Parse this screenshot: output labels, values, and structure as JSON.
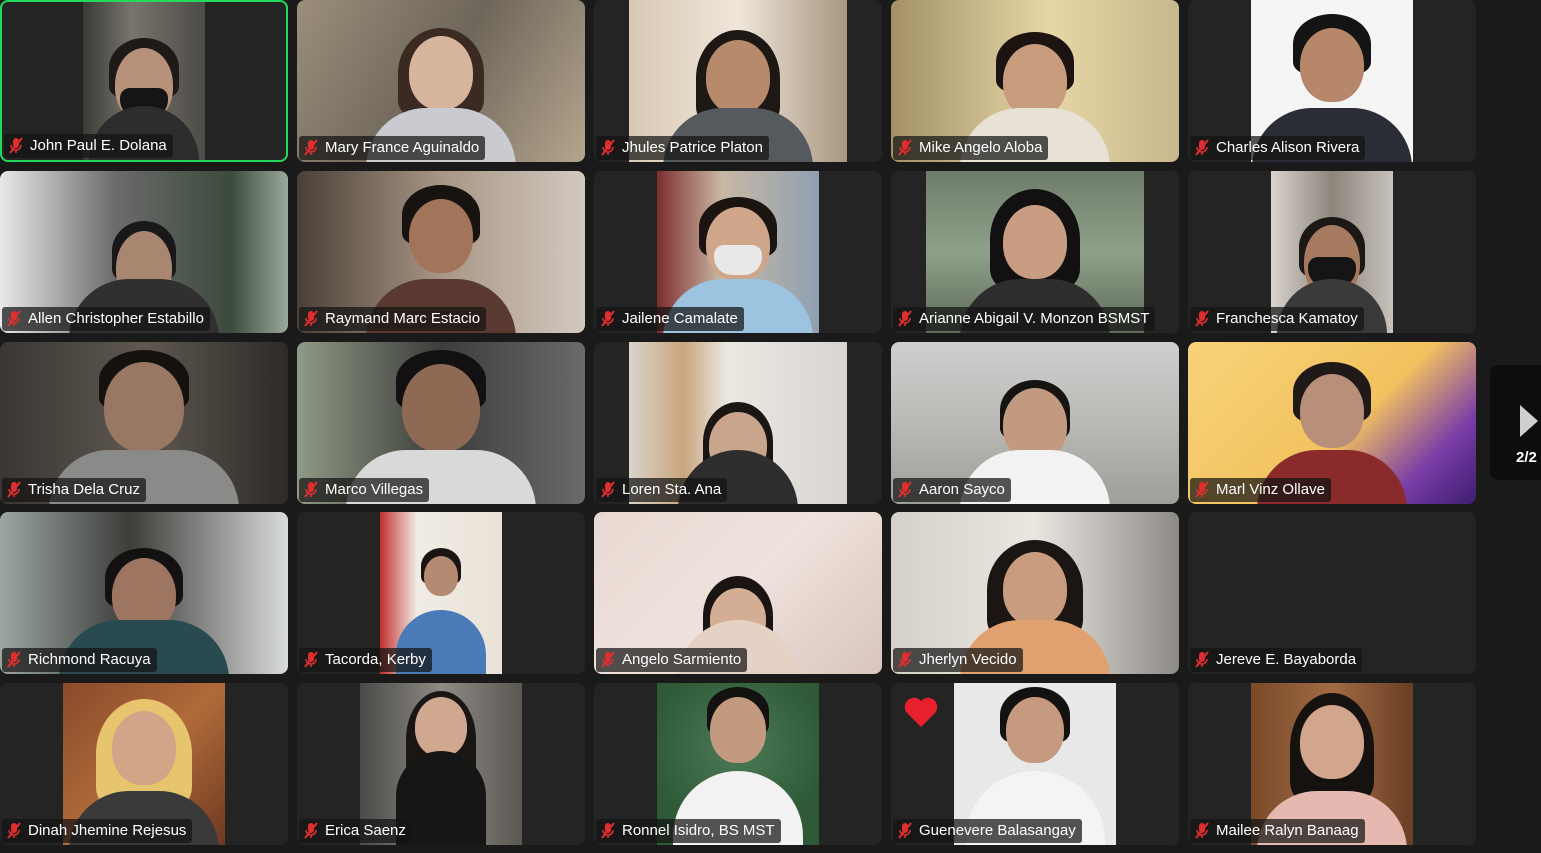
{
  "pagination": {
    "page_indicator": "2/2"
  },
  "colors": {
    "active_speaker_border": "#23d959",
    "muted_icon": "#e02e2e",
    "background": "#1a1a1a",
    "tile_background": "#242424"
  },
  "participants": [
    {
      "name": "John Paul E. Dolana",
      "muted": true,
      "active": true
    },
    {
      "name": "Mary France Aguinaldo",
      "muted": true
    },
    {
      "name": "Jhules Patrice Platon",
      "muted": true
    },
    {
      "name": "Mike Angelo Aloba",
      "muted": true
    },
    {
      "name": "Charles Alison Rivera",
      "muted": true
    },
    {
      "name": "Allen Christopher Estabillo",
      "muted": true
    },
    {
      "name": "Raymand Marc Estacio",
      "muted": true
    },
    {
      "name": "Jailene Camalate",
      "muted": true
    },
    {
      "name": "Arianne Abigail V. Monzon BSMST",
      "muted": true
    },
    {
      "name": "Franchesca Kamatoy",
      "muted": true
    },
    {
      "name": "Trisha Dela Cruz",
      "muted": true
    },
    {
      "name": "Marco Villegas",
      "muted": true
    },
    {
      "name": "Loren Sta. Ana",
      "muted": true
    },
    {
      "name": "Aaron Sayco",
      "muted": true
    },
    {
      "name": "Marl Vinz Ollave",
      "muted": true
    },
    {
      "name": "Richmond Racuya",
      "muted": true
    },
    {
      "name": "Tacorda, Kerby",
      "muted": true
    },
    {
      "name": "Angelo Sarmiento",
      "muted": true
    },
    {
      "name": "Jherlyn Vecido",
      "muted": true
    },
    {
      "name": "Jereve E. Bayaborda",
      "muted": true,
      "video_off": true
    },
    {
      "name": "Dinah Jhemine Rejesus",
      "muted": true
    },
    {
      "name": "Erica Saenz",
      "muted": true
    },
    {
      "name": "Ronnel Isidro, BS MST",
      "muted": true
    },
    {
      "name": "Guenevere Balasangay",
      "muted": true,
      "reaction": "heart-icon"
    },
    {
      "name": "Mailee Ralyn Banaag",
      "muted": true
    }
  ]
}
